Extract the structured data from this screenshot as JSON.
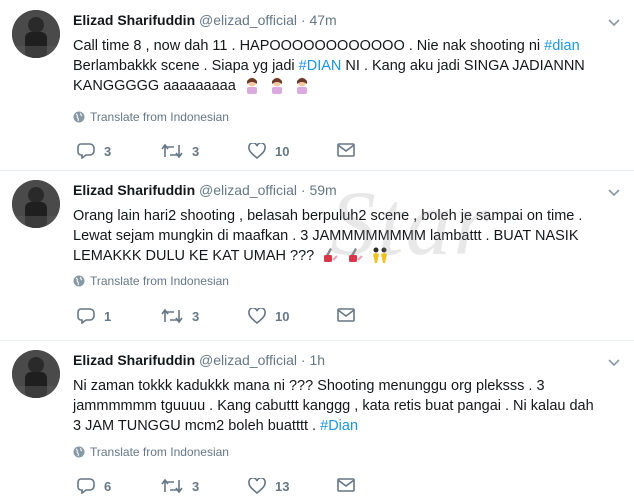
{
  "tweets": [
    {
      "name": "Elizad Sharifuddin",
      "handle": "@elizad_official",
      "separator": "·",
      "time": "47m",
      "lines": [
        {
          "pre": "Call time 8 , now dah 11 .  HAPOOOOOOOOOOOO . Nie nak shooting ni ",
          "tag": "#dian",
          "post": ""
        },
        {
          "pre": "Berlambakkk scene . Siapa yg jadi ",
          "tag": "#DIAN",
          "post": " NI . Kang aku jadi SINGA JADIANNN"
        },
        {
          "pre": "KANGGGGG aaaaaaaaa",
          "tag": "",
          "post": ""
        }
      ],
      "emoji": [
        "woman-gesturing-icon",
        "woman-gesturing-icon",
        "woman-gesturing-icon"
      ],
      "translate": "Translate from Indonesian",
      "replies": "3",
      "retweets": "3",
      "likes": "10"
    },
    {
      "name": "Elizad Sharifuddin",
      "handle": "@elizad_official",
      "separator": "·",
      "time": "59m",
      "lines": [
        {
          "pre": "Orang lain hari2 shooting , belasah berpuluh2 scene , boleh je sampai on time .",
          "tag": "",
          "post": ""
        },
        {
          "pre": "Lewat sejam mungkin di maafkan . 3 JAMMMMMMMM lambattt . BUAT NASIK",
          "tag": "",
          "post": ""
        },
        {
          "pre": "LEMAKKK DULU KE KAT UMAH ???",
          "tag": "",
          "post": ""
        }
      ],
      "emoji": [
        "nail-polish-icon",
        "nail-polish-icon",
        "dancers-icon"
      ],
      "translate": "Translate from Indonesian",
      "replies": "1",
      "retweets": "3",
      "likes": "10"
    },
    {
      "name": "Elizad Sharifuddin",
      "handle": "@elizad_official",
      "separator": "·",
      "time": "1h",
      "lines": [
        {
          "pre": "Ni zaman tokkk kadukkk mana ni ??? Shooting menunggu org pleksss . 3",
          "tag": "",
          "post": ""
        },
        {
          "pre": "jammmmmm tguuuu . Kang cabuttt kanggg , kata retis buat pangai . Ni kalau dah",
          "tag": "",
          "post": ""
        },
        {
          "pre": "3 JAM TUNGGU mcm2 boleh buatttt . ",
          "tag": "#Dian",
          "post": ""
        }
      ],
      "emoji": [],
      "translate": "Translate from Indonesian",
      "replies": "6",
      "retweets": "3",
      "likes": "13"
    }
  ],
  "watermark": "Star",
  "colors": {
    "hashtag": "#1b95e0",
    "meta": "#657786",
    "text": "#14171a"
  }
}
